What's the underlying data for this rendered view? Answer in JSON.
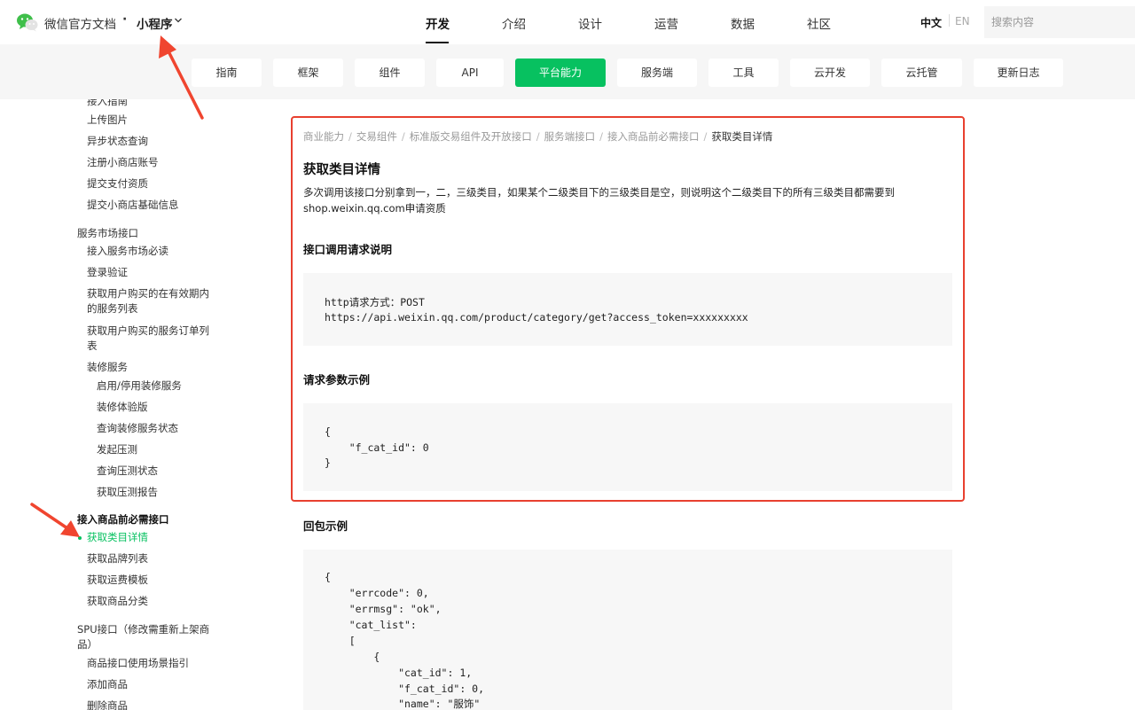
{
  "header": {
    "brand": "微信官方文档",
    "separator": "·",
    "product": "小程序",
    "nav": [
      "开发",
      "介绍",
      "设计",
      "运营",
      "数据",
      "社区"
    ],
    "lang_zh": "中文",
    "lang_en": "EN",
    "search_placeholder": "搜索内容"
  },
  "subnav": [
    "指南",
    "框架",
    "组件",
    "API",
    "平台能力",
    "服务端",
    "工具",
    "云开发",
    "云托管",
    "更新日志"
  ],
  "sidebar": {
    "cut_item": "接入指南",
    "items": [
      "上传图片",
      "异步状态查询",
      "注册小商店账号",
      "提交支付资质",
      "提交小商店基础信息",
      "服务市场接口",
      "接入服务市场必读",
      "登录验证",
      "获取用户购买的在有效期内",
      "的服务列表",
      "获取用户购买的服务订单列",
      "表",
      "装修服务",
      "启用/停用装修服务",
      "装修体验版",
      "查询装修服务状态",
      "发起压测",
      "查询压测状态",
      "获取压测报告",
      "接入商品前必需接口",
      "获取类目详情",
      "获取品牌列表",
      "获取运费模板",
      "获取商品分类",
      "SPU接口（修改需重新上架商",
      "品）",
      "商品接口使用场景指引",
      "添加商品",
      "删除商品"
    ]
  },
  "content": {
    "breadcrumb": [
      "商业能力",
      "交易组件",
      "标准版交易组件及开放接口",
      "服务端接口",
      "接入商品前必需接口",
      "获取类目详情"
    ],
    "title": "获取类目详情",
    "desc_line1": "多次调用该接口分别拿到一，二，三级类目，如果某个二级类目下的三级类目是空，则说明这个二级类目下的所有三级类目都需要到",
    "desc_line2": "shop.weixin.qq.com申请资质",
    "section_request": "接口调用请求说明",
    "request_lines": [
      "http请求方式：POST",
      "https://api.weixin.qq.com/product/category/get?access_token=xxxxxxxxx"
    ],
    "section_params": "请求参数示例",
    "params_lines": [
      "{",
      "    \"f_cat_id\": 0",
      "}"
    ],
    "section_response": "回包示例",
    "response_lines": [
      "{",
      "    \"errcode\": 0,",
      "    \"errmsg\": \"ok\",",
      "    \"cat_list\":",
      "    [",
      "        {",
      "            \"cat_id\": 1,",
      "            \"f_cat_id\": 0,",
      "            \"name\": \"服饰\""
    ]
  },
  "colors": {
    "accent": "#07c160",
    "highlight_border": "#e8402f",
    "arrow": "#f0452f"
  }
}
